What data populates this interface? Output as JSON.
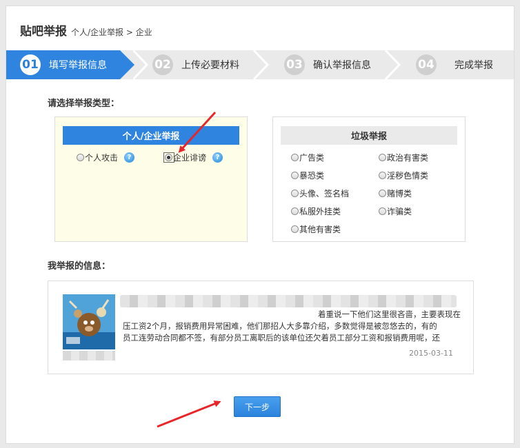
{
  "header": {
    "title": "贴吧举报",
    "breadcrumb": "个人/企业举报 > 企业"
  },
  "steps": [
    {
      "num": "01",
      "label": "填写举报信息",
      "active": true
    },
    {
      "num": "02",
      "label": "上传必要材料",
      "active": false
    },
    {
      "num": "03",
      "label": "确认举报信息",
      "active": false
    },
    {
      "num": "04",
      "label": "完成举报",
      "active": false
    }
  ],
  "type_section": {
    "label": "请选择举报类型："
  },
  "personal_box": {
    "title": "个人/企业举报",
    "options": [
      {
        "label": "个人攻击",
        "checked": false
      },
      {
        "label": "企业诽谤",
        "checked": true
      }
    ]
  },
  "spam_box": {
    "title": "垃圾举报",
    "options": [
      "广告类",
      "政治有害类",
      "暴恐类",
      "淫秽色情类",
      "头像、签名档",
      "赌博类",
      "私服外挂类",
      "诈骗类",
      "其他有害类"
    ]
  },
  "info_section": {
    "label": "我举报的信息：",
    "post_line1": "着重说一下他们这里很吝啬，主要表现在",
    "post_line2": "压工资2个月，报销费用异常困难，他们那招人大多靠介绍，多数觉得是被忽悠去的，有的",
    "post_line3": "员工连劳动合同都不签，有部分员工离职后的该单位还欠着员工部分工资和报销费用呢，还",
    "date": "2015-03-11"
  },
  "next_button": {
    "label": "下一步"
  },
  "colors": {
    "accent": "#2e84de",
    "step_bg": "#eaeaea",
    "arrow": "#e8262a"
  }
}
